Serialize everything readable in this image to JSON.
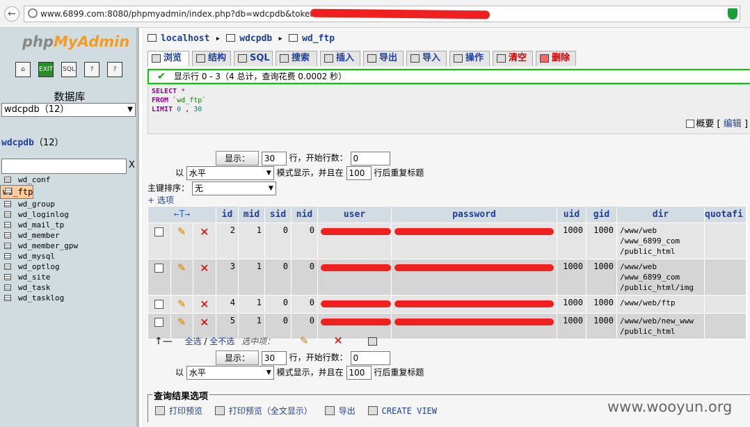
{
  "browser": {
    "url": "www.6899.com:8080/phpmyadmin/index.php?db=wdcpdb&token="
  },
  "sidebar": {
    "logo_left": "php",
    "logo_right": "MyAdmin",
    "toolbar_icons": [
      "home-icon",
      "exit-icon",
      "sql-icon",
      "help-icon",
      "docs-icon"
    ],
    "database_label": "数据库",
    "database_selected": "wdcpdb（12）",
    "db_name": "wdcpdb",
    "db_count": "（12）",
    "filter_clear": "X",
    "tables": [
      "wd_conf",
      "wd_ftp",
      "wd_group",
      "wd_loginlog",
      "wd_mail_tp",
      "wd_member",
      "wd_member_gpw",
      "wd_mysql",
      "wd_optlog",
      "wd_site",
      "wd_task",
      "wd_tasklog"
    ],
    "selected_table": "wd_ftp"
  },
  "breadcrumb": {
    "server": "localhost",
    "db": "wdcpdb",
    "table": "wd_ftp"
  },
  "tabs": [
    {
      "label": "浏览",
      "active": true
    },
    {
      "label": "结构"
    },
    {
      "label": "SQL"
    },
    {
      "label": "搜索"
    },
    {
      "label": "插入"
    },
    {
      "label": "导出"
    },
    {
      "label": "导入"
    },
    {
      "label": "操作"
    },
    {
      "label": "清空"
    },
    {
      "label": "删除"
    }
  ],
  "notice": "显示行 0 - 3（4 总计，查询花费 0.0002 秒）",
  "sql": {
    "line1_kw": "SELECT",
    "line1_rest": " *",
    "line2_kw": "FROM",
    "line2_table": "`wd_ftp`",
    "line3_kw": "LIMIT",
    "line3_a": "0",
    "line3_sep": " , ",
    "line3_b": "30"
  },
  "overview": {
    "label": "概要",
    "open": "[",
    "edit": "编辑",
    "close": "]"
  },
  "nav_top": {
    "show_button": "显示：",
    "rows_value": "30",
    "start_label": "行，开始行数：",
    "start_value": "0",
    "mode_prefix": "以",
    "mode_value": "水平",
    "mode_suffix": "模式显示，并且在",
    "repeat_value": "100",
    "repeat_suffix": "行后重复标题",
    "sort_label": "主键排序：",
    "sort_value": "无",
    "options_link": "+ 选项"
  },
  "grid": {
    "sort_arrows": "←T→",
    "columns": [
      "id",
      "mid",
      "sid",
      "nid",
      "user",
      "password",
      "uid",
      "gid",
      "dir",
      "quotafi"
    ],
    "rows": [
      {
        "id": "2",
        "mid": "1",
        "sid": "0",
        "nid": "0",
        "user": "",
        "password": "",
        "uid": "1000",
        "gid": "1000",
        "dir": [
          "/www/web",
          "/www_6899_com",
          "/public_html"
        ]
      },
      {
        "id": "3",
        "mid": "1",
        "sid": "0",
        "nid": "0",
        "user": "",
        "password": "",
        "uid": "1000",
        "gid": "1000",
        "dir": [
          "/www/web",
          "/www_6899_com",
          "/public_html/img"
        ]
      },
      {
        "id": "4",
        "mid": "1",
        "sid": "0",
        "nid": "0",
        "user": "",
        "password": "",
        "uid": "1000",
        "gid": "1000",
        "dir": [
          "/www/web/ftp"
        ]
      },
      {
        "id": "5",
        "mid": "1",
        "sid": "0",
        "nid": "0",
        "user": "",
        "password": "",
        "uid": "1000",
        "gid": "1000",
        "dir": [
          "/www/web/new_www",
          "/public_html"
        ]
      }
    ]
  },
  "bulk": {
    "arrow": "↑—",
    "select_all": "全选",
    "slash": " / ",
    "select_none": "全不选",
    "with_selected": "选中项："
  },
  "nav_bottom": {
    "show_button": "显示：",
    "rows_value": "30",
    "start_label": "行，开始行数：",
    "start_value": "0",
    "mode_prefix": "以",
    "mode_value": "水平",
    "mode_suffix": "模式显示，并且在",
    "repeat_value": "100",
    "repeat_suffix": "行后重复标题"
  },
  "query_results": {
    "legend": "查询结果选项",
    "print_view": "打印预览",
    "print_view_full": "打印预览（全文显示）",
    "export": "导出",
    "create_view": "CREATE VIEW"
  },
  "watermark": "www.wooyun.org"
}
